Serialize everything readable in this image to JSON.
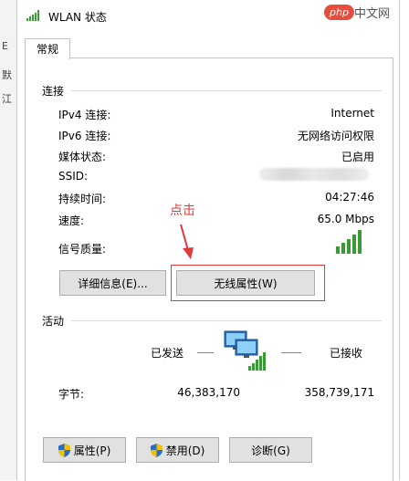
{
  "window": {
    "title": "WLAN 状态",
    "tab": "常规",
    "watermark": "php中文网"
  },
  "background": {
    "marks": [
      "E",
      "默",
      "江"
    ]
  },
  "connection": {
    "heading": "连接",
    "rows": [
      {
        "label": "IPv4 连接:",
        "value": "Internet"
      },
      {
        "label": "IPv6 连接:",
        "value": "无网络访问权限"
      },
      {
        "label": "媒体状态:",
        "value": "已启用"
      },
      {
        "label": "SSID:",
        "value": ""
      },
      {
        "label": "持续时间:",
        "value": "04:27:46"
      },
      {
        "label": "速度:",
        "value": "65.0 Mbps"
      }
    ],
    "signal_label": "信号质量:",
    "signal_bars": 5
  },
  "buttons": {
    "details": "详细信息(E)...",
    "wireless_props": "无线属性(W)"
  },
  "annotation": {
    "text": "点击",
    "color": "#e0393b"
  },
  "activity": {
    "heading": "活动",
    "sent_label": "已发送",
    "received_label": "已接收",
    "bytes_label": "字节:",
    "bytes_sent": "46,383,170",
    "bytes_received": "358,739,171"
  },
  "footer": {
    "properties": "属性(P)",
    "disable": "禁用(D)",
    "diagnose": "诊断(G)"
  },
  "colors": {
    "signal": "#3b9a35",
    "shield_blue": "#2a6dc4",
    "shield_yellow": "#f2c200"
  }
}
